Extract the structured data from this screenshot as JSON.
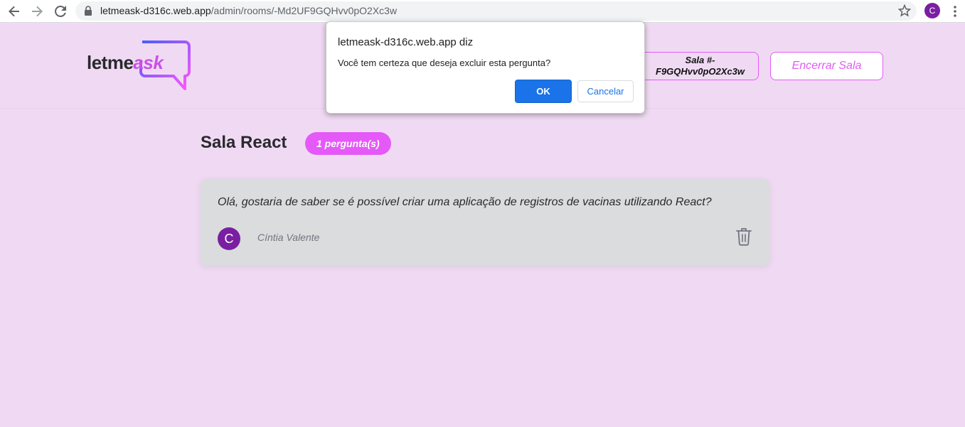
{
  "browser": {
    "url_domain": "letmeask-d316c.web.app",
    "url_path": "/admin/rooms/-Md2UF9GQHvv0pO2Xc3w",
    "profile_initial": "C"
  },
  "header": {
    "logo_prefix": "letme",
    "logo_suffix": "ask",
    "room_code_line1": "Sala #-",
    "room_code_line2": "F9GQHvv0pO2Xc3w",
    "end_room_label": "Encerrar Sala",
    "brand_color": "#e559f9"
  },
  "room": {
    "title": "Sala React",
    "question_count": "1 pergunta(s)"
  },
  "questions": [
    {
      "content": "Olá, gostaria de saber se é possível criar uma aplicação de registros de vacinas utilizando React?",
      "author_initial": "C",
      "author_name": "Cíntia Valente"
    }
  ],
  "dialog": {
    "title": "letmeask-d316c.web.app diz",
    "message": "Você tem certeza que deseja excluir esta pergunta?",
    "ok_label": "OK",
    "cancel_label": "Cancelar"
  }
}
